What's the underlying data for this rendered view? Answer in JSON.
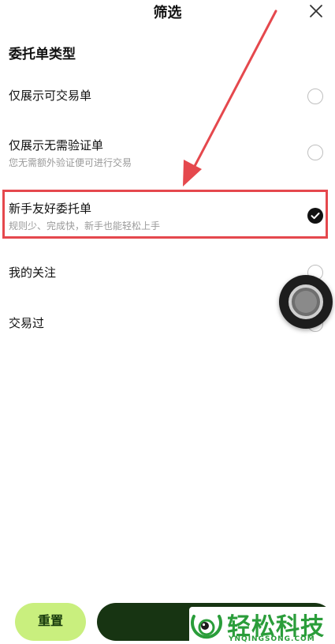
{
  "header": {
    "title": "筛选",
    "close_icon": "close-icon"
  },
  "section": {
    "title": "委托单类型"
  },
  "options": [
    {
      "label": "仅展示可交易单",
      "sub": "",
      "checked": false
    },
    {
      "label": "仅展示无需验证单",
      "sub": "您无需额外验证便可进行交易",
      "checked": false
    },
    {
      "label": "新手友好委托单",
      "sub": "规则少、完成快，新手也能轻松上手",
      "checked": true
    },
    {
      "label": "我的关注",
      "sub": "",
      "checked": false
    },
    {
      "label": "交易过",
      "sub": "",
      "checked": false
    }
  ],
  "footer": {
    "reset_label": "重置",
    "confirm_label": ""
  },
  "watermark": {
    "text": "轻松科技",
    "sub": "YNQINGSONG.COM"
  },
  "colors": {
    "accent_green": "#c9ef7e",
    "confirm_dark": "#173412",
    "annotation_red": "#e5484d",
    "watermark_green": "#2a9d3a"
  }
}
